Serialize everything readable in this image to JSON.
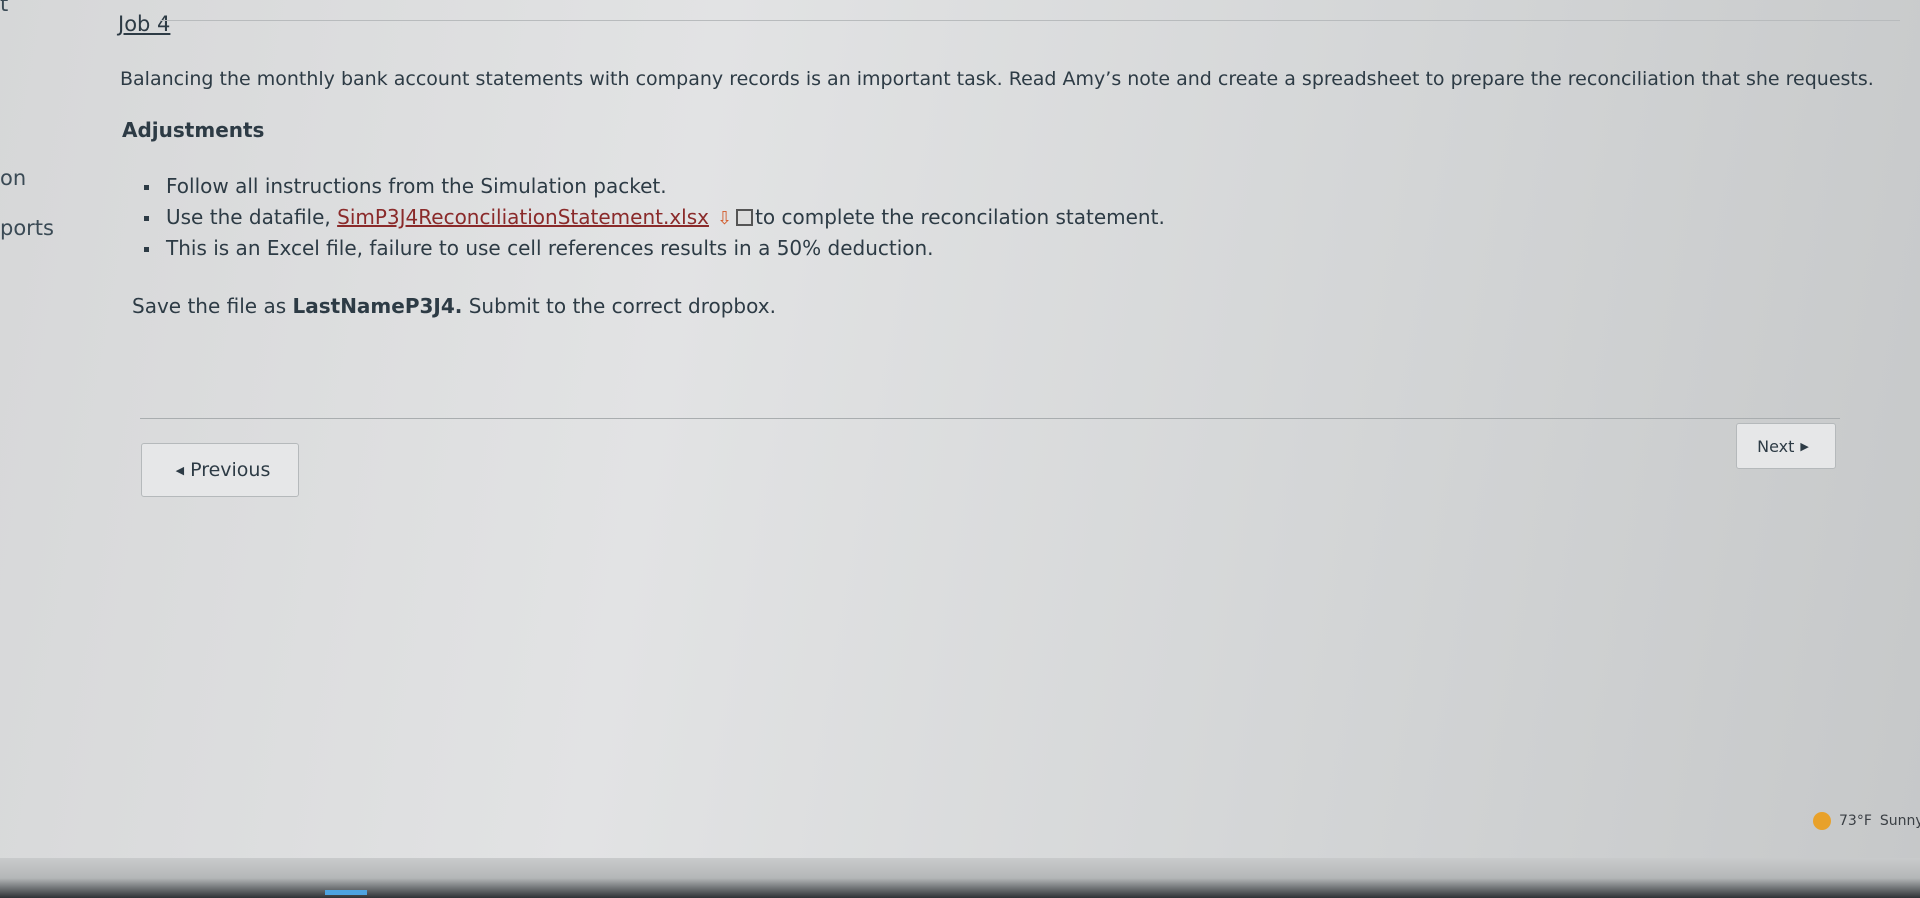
{
  "sidebar": {
    "frag_top": "t",
    "frag_mid": "on",
    "frag_low": "ports"
  },
  "page": {
    "heading": "Job 4",
    "intro": "Balancing the monthly bank account statements with company records is an important task.  Read Amy’s note and create a spreadsheet to prepare the reconciliation that she requests.",
    "section_heading": "Adjustments",
    "bullets": {
      "b1": "Follow all instructions from the Simulation packet.",
      "b2_prefix": "Use the datafile, ",
      "b2_link": "SimP3J4ReconciliationStatement.xlsx",
      "b2_suffix": "to complete the reconcilation statement.",
      "b3": "This is an Excel file, failure to use cell references results in a 50% deduction."
    },
    "save_note_prefix": "Save the file as ",
    "save_note_bold": "LastNameP3J4.",
    "save_note_suffix": "  Submit to the correct dropbox."
  },
  "nav": {
    "previous_label": "Previous",
    "next_label": "Next"
  },
  "taskbar": {
    "weather_temp": "73°F",
    "weather_cond": "Sunny"
  }
}
